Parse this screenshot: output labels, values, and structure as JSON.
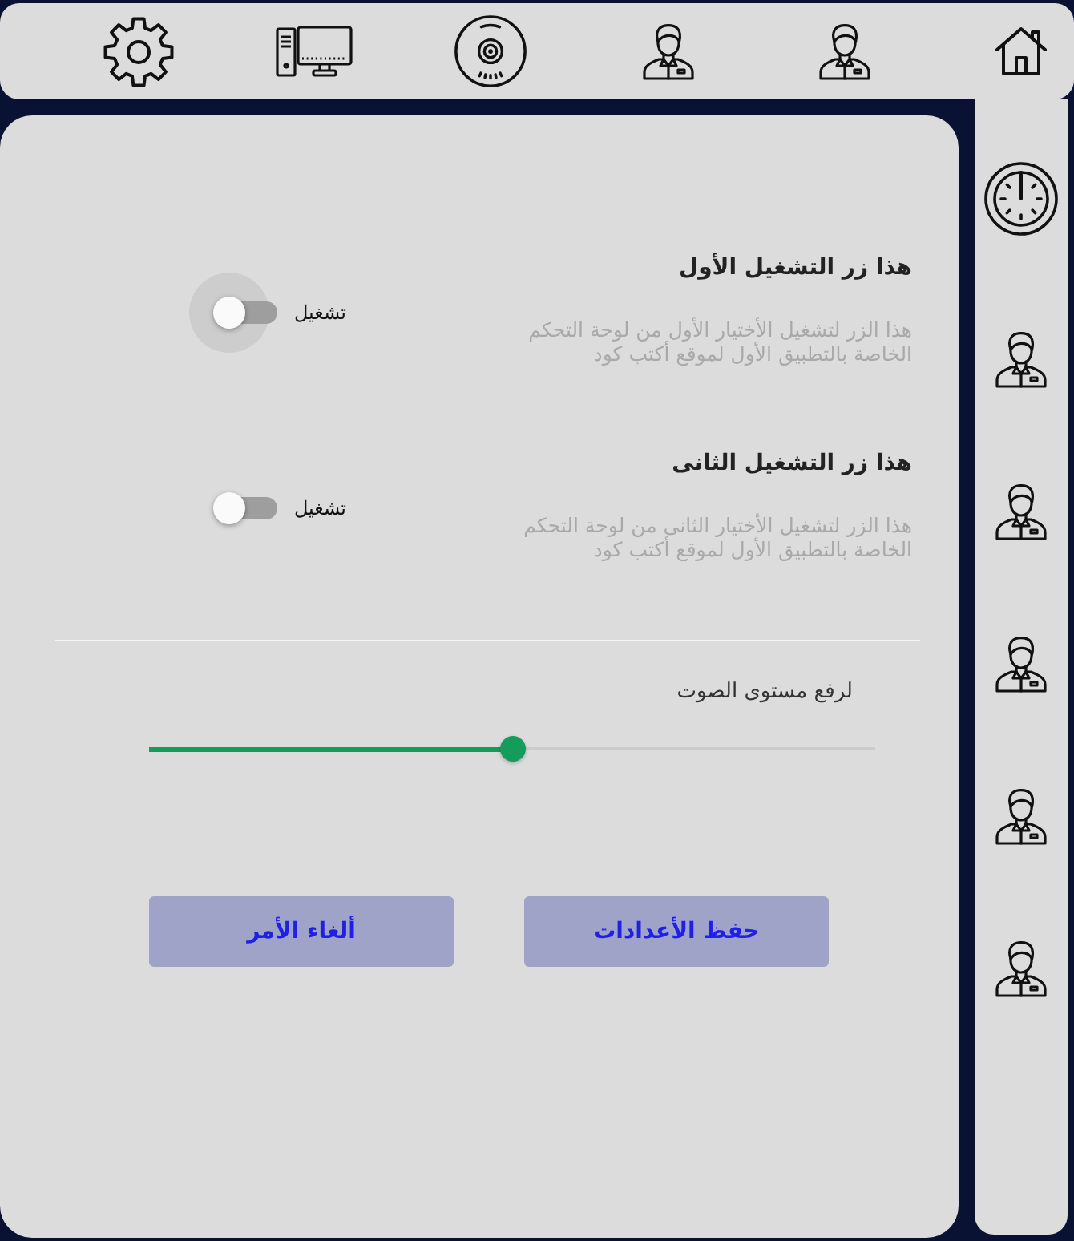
{
  "toolbar": {
    "items": [
      {
        "kind": "home"
      },
      {
        "kind": "person"
      },
      {
        "kind": "person"
      },
      {
        "kind": "disc"
      },
      {
        "kind": "computer"
      },
      {
        "kind": "gear"
      }
    ]
  },
  "sidebar": {
    "items": [
      {
        "kind": "gauge"
      },
      {
        "kind": "person"
      },
      {
        "kind": "person"
      },
      {
        "kind": "person"
      },
      {
        "kind": "person"
      },
      {
        "kind": "person"
      }
    ]
  },
  "settings": [
    {
      "title": "هذا زر التشغيل الأول",
      "description": "هذا الزر لتشغيل الأختيار الأول من لوحة التحكم الخاصة بالتطبيق الأول لموقع أكتب كود",
      "switch_label": "تشغيل",
      "checked": false,
      "focused": true
    },
    {
      "title": "هذا زر التشغيل الثانى",
      "description": "هذا الزر لتشغيل الأختيار الثانى من لوحة التحكم الخاصة بالتطبيق الأول لموقع أكتب كود",
      "switch_label": "تشغيل",
      "checked": false,
      "focused": false
    }
  ],
  "volume": {
    "label": "لرفع مستوى الصوت",
    "level": 0.5
  },
  "buttons": [
    {
      "label": "حفظ الأعدادات"
    },
    {
      "label": "ألغاء الأمر"
    }
  ]
}
